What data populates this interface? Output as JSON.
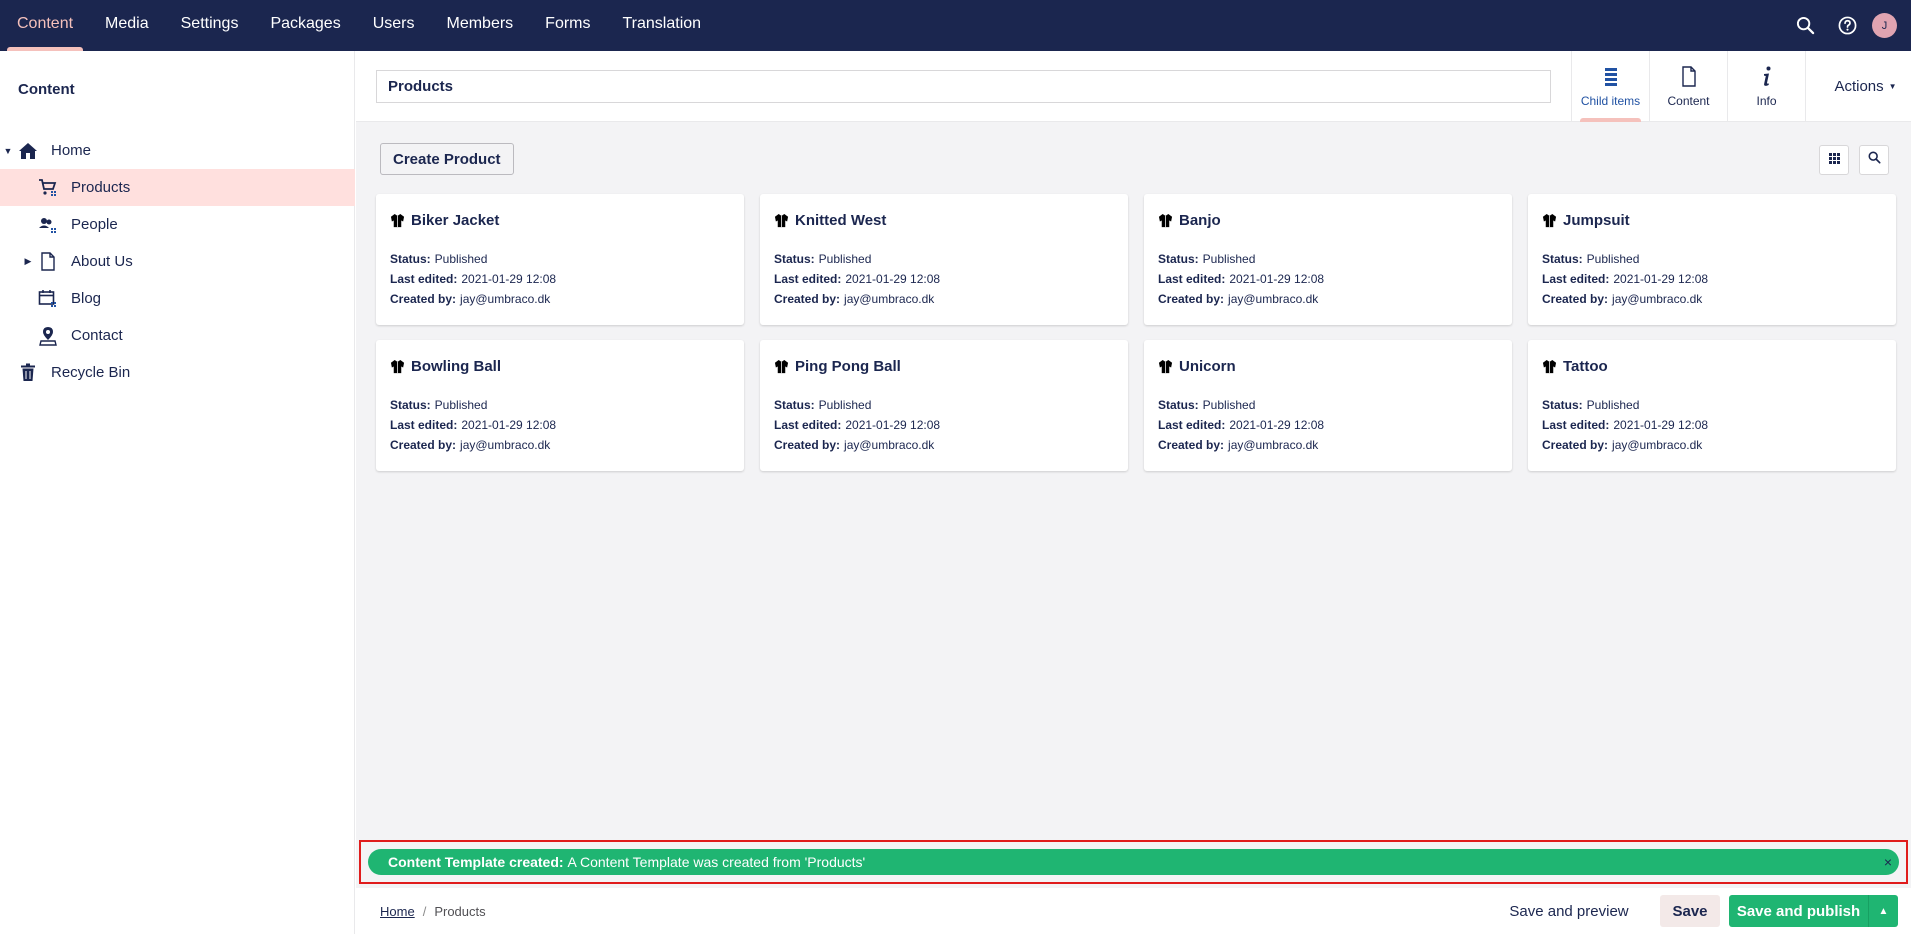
{
  "topnav": {
    "sections": [
      "Content",
      "Media",
      "Settings",
      "Packages",
      "Users",
      "Members",
      "Forms",
      "Translation"
    ],
    "active_section": "Content",
    "avatar_initial": "J"
  },
  "sidebar": {
    "title": "Content",
    "tree": [
      {
        "label": "Home",
        "icon": "home-icon",
        "expanded": true
      },
      {
        "label": "Products",
        "icon": "shopping-cart-icon",
        "selected": true
      },
      {
        "label": "People",
        "icon": "people-icon"
      },
      {
        "label": "About Us",
        "icon": "document-icon",
        "has_children": true
      },
      {
        "label": "Blog",
        "icon": "calendar-icon"
      },
      {
        "label": "Contact",
        "icon": "map-pin-icon"
      },
      {
        "label": "Recycle Bin",
        "icon": "trash-icon"
      }
    ]
  },
  "editor": {
    "name_value": "Products",
    "apps": [
      {
        "label": "Child items",
        "icon": "list-icon",
        "active": true
      },
      {
        "label": "Content",
        "icon": "document-icon"
      },
      {
        "label": "Info",
        "icon": "info-icon"
      }
    ],
    "actions_label": "Actions"
  },
  "listview": {
    "create_label": "Create Product",
    "field_labels": {
      "status": "Status:",
      "last_edited": "Last edited:",
      "created_by": "Created by:"
    },
    "items": [
      {
        "name": "Biker Jacket",
        "status": "Published",
        "last_edited": "2021-01-29 12:08",
        "created_by": "jay@umbraco.dk"
      },
      {
        "name": "Knitted West",
        "status": "Published",
        "last_edited": "2021-01-29 12:08",
        "created_by": "jay@umbraco.dk"
      },
      {
        "name": "Banjo",
        "status": "Published",
        "last_edited": "2021-01-29 12:08",
        "created_by": "jay@umbraco.dk"
      },
      {
        "name": "Jumpsuit",
        "status": "Published",
        "last_edited": "2021-01-29 12:08",
        "created_by": "jay@umbraco.dk"
      },
      {
        "name": "Bowling Ball",
        "status": "Published",
        "last_edited": "2021-01-29 12:08",
        "created_by": "jay@umbraco.dk"
      },
      {
        "name": "Ping Pong Ball",
        "status": "Published",
        "last_edited": "2021-01-29 12:08",
        "created_by": "jay@umbraco.dk"
      },
      {
        "name": "Unicorn",
        "status": "Published",
        "last_edited": "2021-01-29 12:08",
        "created_by": "jay@umbraco.dk"
      },
      {
        "name": "Tattoo",
        "status": "Published",
        "last_edited": "2021-01-29 12:08",
        "created_by": "jay@umbraco.dk"
      }
    ]
  },
  "notification": {
    "headline": "Content Template created:",
    "message": "A Content Template was created from 'Products'",
    "close": "×"
  },
  "footer": {
    "breadcrumb": [
      {
        "label": "Home"
      },
      {
        "label": "Products"
      }
    ],
    "separator": "/",
    "save_preview_label": "Save and preview",
    "save_label": "Save",
    "publish_label": "Save and publish"
  },
  "colors": {
    "nav_bg": "#1b264f",
    "accent_pink": "#f5c1bc",
    "selected_bg": "#ffe0de",
    "success": "#1fb572",
    "highlight_border": "#e01c1c"
  }
}
